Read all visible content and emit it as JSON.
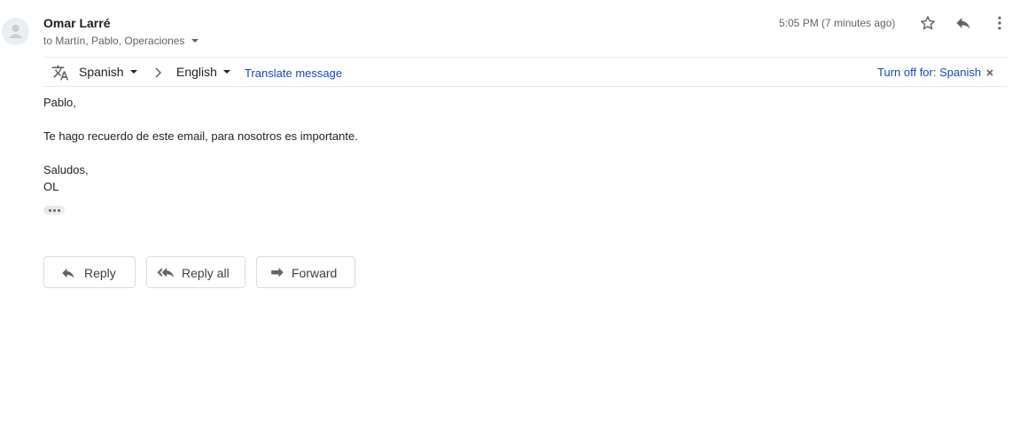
{
  "header": {
    "sender_name": "Omar Larré",
    "recipients": "to Martín, Pablo, Operaciones",
    "timestamp": "5:05 PM (7 minutes ago)"
  },
  "icons": {
    "avatar": "person-avatar-icon",
    "star": "star-outline-icon",
    "reply": "reply-icon",
    "more": "more-vert-icon",
    "translate": "translate-icon",
    "arrow": "chevron-right-icon",
    "close": "close-icon",
    "ellipsis": "show-trimmed-content-icon",
    "reply_all": "reply-all-icon",
    "forward": "forward-icon"
  },
  "translate_bar": {
    "source_language": "Spanish",
    "target_language": "English",
    "translate_link": "Translate message",
    "turn_off_link": "Turn off for: Spanish"
  },
  "message": {
    "greeting": "Pablo,",
    "line1": "Te hago recuerdo de este email, para nosotros es importante.",
    "closing": "Saludos,",
    "signature": "OL"
  },
  "actions": {
    "reply": "Reply",
    "reply_all": "Reply all",
    "forward": "Forward"
  },
  "colors": {
    "link": "#1a47b4",
    "secondary_text": "#5f6368",
    "border": "#dadce0"
  }
}
